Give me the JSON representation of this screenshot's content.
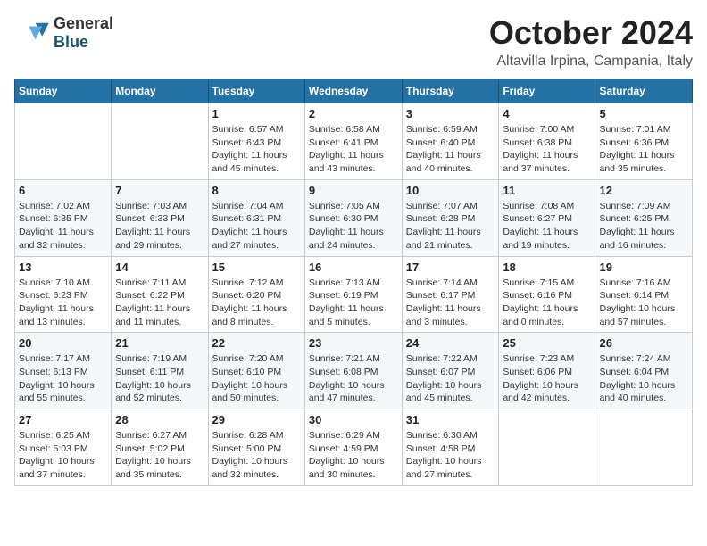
{
  "logo": {
    "general": "General",
    "blue": "Blue"
  },
  "title": {
    "month": "October 2024",
    "location": "Altavilla Irpina, Campania, Italy"
  },
  "headers": [
    "Sunday",
    "Monday",
    "Tuesday",
    "Wednesday",
    "Thursday",
    "Friday",
    "Saturday"
  ],
  "weeks": [
    [
      {
        "day": null
      },
      {
        "day": null
      },
      {
        "day": "1",
        "sunrise": "Sunrise: 6:57 AM",
        "sunset": "Sunset: 6:43 PM",
        "daylight": "Daylight: 11 hours and 45 minutes."
      },
      {
        "day": "2",
        "sunrise": "Sunrise: 6:58 AM",
        "sunset": "Sunset: 6:41 PM",
        "daylight": "Daylight: 11 hours and 43 minutes."
      },
      {
        "day": "3",
        "sunrise": "Sunrise: 6:59 AM",
        "sunset": "Sunset: 6:40 PM",
        "daylight": "Daylight: 11 hours and 40 minutes."
      },
      {
        "day": "4",
        "sunrise": "Sunrise: 7:00 AM",
        "sunset": "Sunset: 6:38 PM",
        "daylight": "Daylight: 11 hours and 37 minutes."
      },
      {
        "day": "5",
        "sunrise": "Sunrise: 7:01 AM",
        "sunset": "Sunset: 6:36 PM",
        "daylight": "Daylight: 11 hours and 35 minutes."
      }
    ],
    [
      {
        "day": "6",
        "sunrise": "Sunrise: 7:02 AM",
        "sunset": "Sunset: 6:35 PM",
        "daylight": "Daylight: 11 hours and 32 minutes."
      },
      {
        "day": "7",
        "sunrise": "Sunrise: 7:03 AM",
        "sunset": "Sunset: 6:33 PM",
        "daylight": "Daylight: 11 hours and 29 minutes."
      },
      {
        "day": "8",
        "sunrise": "Sunrise: 7:04 AM",
        "sunset": "Sunset: 6:31 PM",
        "daylight": "Daylight: 11 hours and 27 minutes."
      },
      {
        "day": "9",
        "sunrise": "Sunrise: 7:05 AM",
        "sunset": "Sunset: 6:30 PM",
        "daylight": "Daylight: 11 hours and 24 minutes."
      },
      {
        "day": "10",
        "sunrise": "Sunrise: 7:07 AM",
        "sunset": "Sunset: 6:28 PM",
        "daylight": "Daylight: 11 hours and 21 minutes."
      },
      {
        "day": "11",
        "sunrise": "Sunrise: 7:08 AM",
        "sunset": "Sunset: 6:27 PM",
        "daylight": "Daylight: 11 hours and 19 minutes."
      },
      {
        "day": "12",
        "sunrise": "Sunrise: 7:09 AM",
        "sunset": "Sunset: 6:25 PM",
        "daylight": "Daylight: 11 hours and 16 minutes."
      }
    ],
    [
      {
        "day": "13",
        "sunrise": "Sunrise: 7:10 AM",
        "sunset": "Sunset: 6:23 PM",
        "daylight": "Daylight: 11 hours and 13 minutes."
      },
      {
        "day": "14",
        "sunrise": "Sunrise: 7:11 AM",
        "sunset": "Sunset: 6:22 PM",
        "daylight": "Daylight: 11 hours and 11 minutes."
      },
      {
        "day": "15",
        "sunrise": "Sunrise: 7:12 AM",
        "sunset": "Sunset: 6:20 PM",
        "daylight": "Daylight: 11 hours and 8 minutes."
      },
      {
        "day": "16",
        "sunrise": "Sunrise: 7:13 AM",
        "sunset": "Sunset: 6:19 PM",
        "daylight": "Daylight: 11 hours and 5 minutes."
      },
      {
        "day": "17",
        "sunrise": "Sunrise: 7:14 AM",
        "sunset": "Sunset: 6:17 PM",
        "daylight": "Daylight: 11 hours and 3 minutes."
      },
      {
        "day": "18",
        "sunrise": "Sunrise: 7:15 AM",
        "sunset": "Sunset: 6:16 PM",
        "daylight": "Daylight: 11 hours and 0 minutes."
      },
      {
        "day": "19",
        "sunrise": "Sunrise: 7:16 AM",
        "sunset": "Sunset: 6:14 PM",
        "daylight": "Daylight: 10 hours and 57 minutes."
      }
    ],
    [
      {
        "day": "20",
        "sunrise": "Sunrise: 7:17 AM",
        "sunset": "Sunset: 6:13 PM",
        "daylight": "Daylight: 10 hours and 55 minutes."
      },
      {
        "day": "21",
        "sunrise": "Sunrise: 7:19 AM",
        "sunset": "Sunset: 6:11 PM",
        "daylight": "Daylight: 10 hours and 52 minutes."
      },
      {
        "day": "22",
        "sunrise": "Sunrise: 7:20 AM",
        "sunset": "Sunset: 6:10 PM",
        "daylight": "Daylight: 10 hours and 50 minutes."
      },
      {
        "day": "23",
        "sunrise": "Sunrise: 7:21 AM",
        "sunset": "Sunset: 6:08 PM",
        "daylight": "Daylight: 10 hours and 47 minutes."
      },
      {
        "day": "24",
        "sunrise": "Sunrise: 7:22 AM",
        "sunset": "Sunset: 6:07 PM",
        "daylight": "Daylight: 10 hours and 45 minutes."
      },
      {
        "day": "25",
        "sunrise": "Sunrise: 7:23 AM",
        "sunset": "Sunset: 6:06 PM",
        "daylight": "Daylight: 10 hours and 42 minutes."
      },
      {
        "day": "26",
        "sunrise": "Sunrise: 7:24 AM",
        "sunset": "Sunset: 6:04 PM",
        "daylight": "Daylight: 10 hours and 40 minutes."
      }
    ],
    [
      {
        "day": "27",
        "sunrise": "Sunrise: 6:25 AM",
        "sunset": "Sunset: 5:03 PM",
        "daylight": "Daylight: 10 hours and 37 minutes."
      },
      {
        "day": "28",
        "sunrise": "Sunrise: 6:27 AM",
        "sunset": "Sunset: 5:02 PM",
        "daylight": "Daylight: 10 hours and 35 minutes."
      },
      {
        "day": "29",
        "sunrise": "Sunrise: 6:28 AM",
        "sunset": "Sunset: 5:00 PM",
        "daylight": "Daylight: 10 hours and 32 minutes."
      },
      {
        "day": "30",
        "sunrise": "Sunrise: 6:29 AM",
        "sunset": "Sunset: 4:59 PM",
        "daylight": "Daylight: 10 hours and 30 minutes."
      },
      {
        "day": "31",
        "sunrise": "Sunrise: 6:30 AM",
        "sunset": "Sunset: 4:58 PM",
        "daylight": "Daylight: 10 hours and 27 minutes."
      },
      {
        "day": null
      },
      {
        "day": null
      }
    ]
  ]
}
